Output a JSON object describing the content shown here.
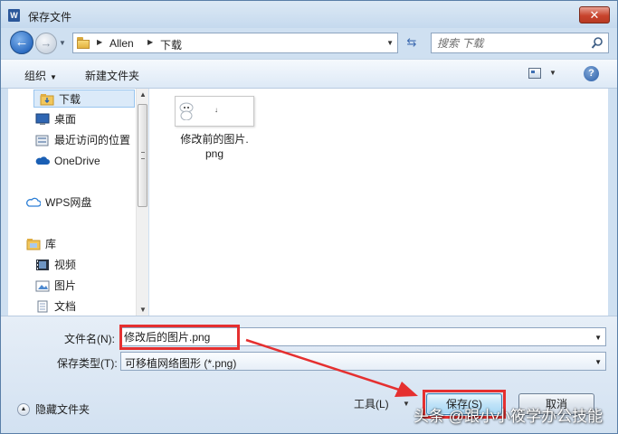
{
  "window": {
    "title": "保存文件",
    "app_icon_letter": "W"
  },
  "nav": {
    "breadcrumb": [
      "Allen",
      "下载"
    ],
    "search_placeholder": "搜索 下载"
  },
  "toolbar": {
    "organize_label": "组织",
    "new_folder_label": "新建文件夹",
    "help_label": "?"
  },
  "sidebar": {
    "items": [
      {
        "label": "下载",
        "icon": "folder-download-icon",
        "selected": true
      },
      {
        "label": "桌面",
        "icon": "desktop-icon"
      },
      {
        "label": "最近访问的位置",
        "icon": "recent-places-icon"
      },
      {
        "label": "OneDrive",
        "icon": "onedrive-icon"
      },
      {
        "label": "WPS网盘",
        "icon": "cloud-drive-icon"
      },
      {
        "label": "库",
        "icon": "library-icon"
      },
      {
        "label": "视频",
        "icon": "video-icon"
      },
      {
        "label": "图片",
        "icon": "pictures-icon"
      },
      {
        "label": "文档",
        "icon": "documents-icon"
      }
    ]
  },
  "files": [
    {
      "name": "修改前的图片.png",
      "name_line1": "修改前的图片.",
      "name_line2": "png"
    }
  ],
  "form": {
    "filename_label": "文件名(N):",
    "filename_value": "修改后的图片.png",
    "filetype_label": "保存类型(T):",
    "filetype_value": "可移植网络图形 (*.png)",
    "hide_folders_label": "隐藏文件夹",
    "tools_label": "工具(L)",
    "save_label": "保存(S)",
    "cancel_label": "取消"
  },
  "watermark": "头条 @跟小小筱学办公技能",
  "colors": {
    "highlight_red": "#e53030",
    "window_blue": "#cfe0f1",
    "selected_bg": "#dbeaf9"
  }
}
